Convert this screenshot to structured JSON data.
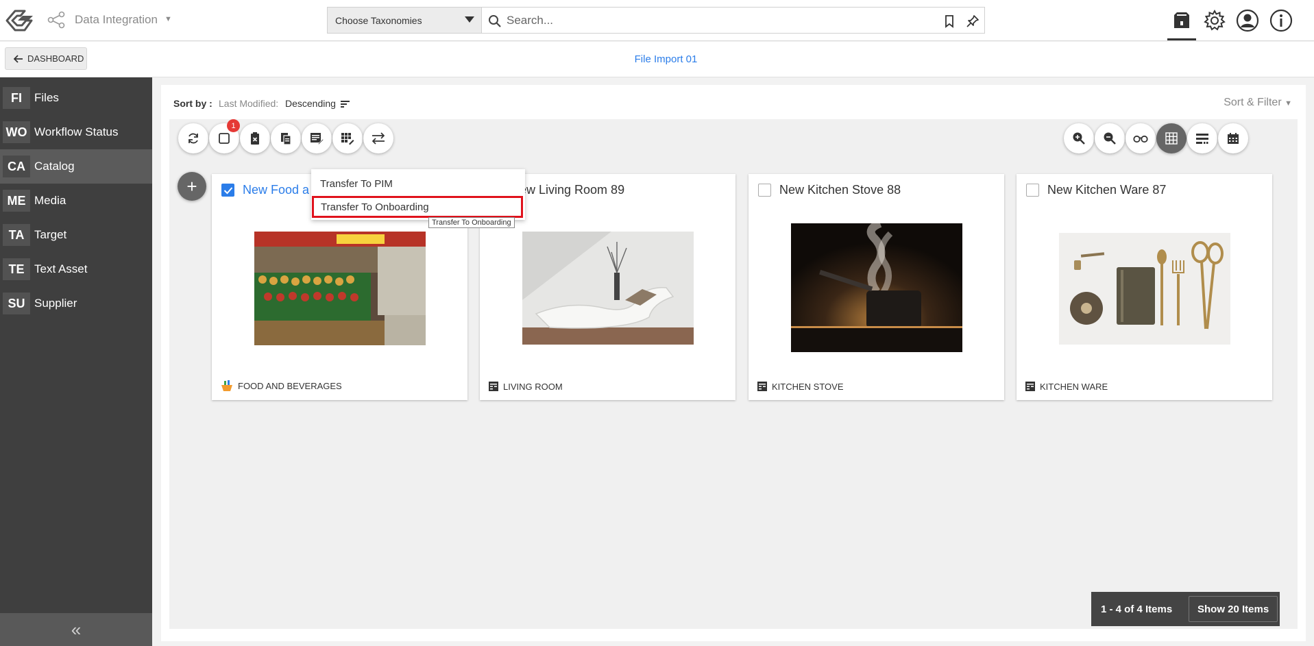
{
  "header": {
    "app_name": "Data Integration",
    "taxonomy_select": "Choose Taxonomies",
    "search_placeholder": "Search..."
  },
  "subbar": {
    "back_label": "DASHBOARD",
    "page_title": "File Import 01"
  },
  "sidebar": {
    "items": [
      {
        "abbr": "FI",
        "label": "Files"
      },
      {
        "abbr": "WO",
        "label": "Workflow Status"
      },
      {
        "abbr": "CA",
        "label": "Catalog",
        "active": true
      },
      {
        "abbr": "ME",
        "label": "Media"
      },
      {
        "abbr": "TA",
        "label": "Target"
      },
      {
        "abbr": "TE",
        "label": "Text Asset"
      },
      {
        "abbr": "SU",
        "label": "Supplier"
      }
    ]
  },
  "sort": {
    "label": "Sort by :",
    "field": "Last Modified:",
    "direction": "Descending",
    "sort_filter": "Sort & Filter"
  },
  "toolbar": {
    "selected_count": "1"
  },
  "menu": {
    "items": [
      "Transfer To PIM",
      "Transfer To Onboarding"
    ],
    "tooltip": "Transfer To Onboarding"
  },
  "cards": [
    {
      "title": "New Food a",
      "category": "FOOD AND BEVERAGES",
      "checked": true
    },
    {
      "title": "New Living Room 89",
      "category": "LIVING ROOM",
      "checked": false
    },
    {
      "title": "New Kitchen Stove 88",
      "category": "KITCHEN STOVE",
      "checked": false
    },
    {
      "title": "New Kitchen Ware 87",
      "category": "KITCHEN WARE",
      "checked": false
    }
  ],
  "pager": {
    "count": "1 - 4 of 4 Items",
    "show": "Show 20 Items"
  },
  "colors": {
    "accent": "#2b7de9",
    "sidebar": "#3f3f3f",
    "highlight": "#e0121c",
    "badge": "#e53935"
  }
}
